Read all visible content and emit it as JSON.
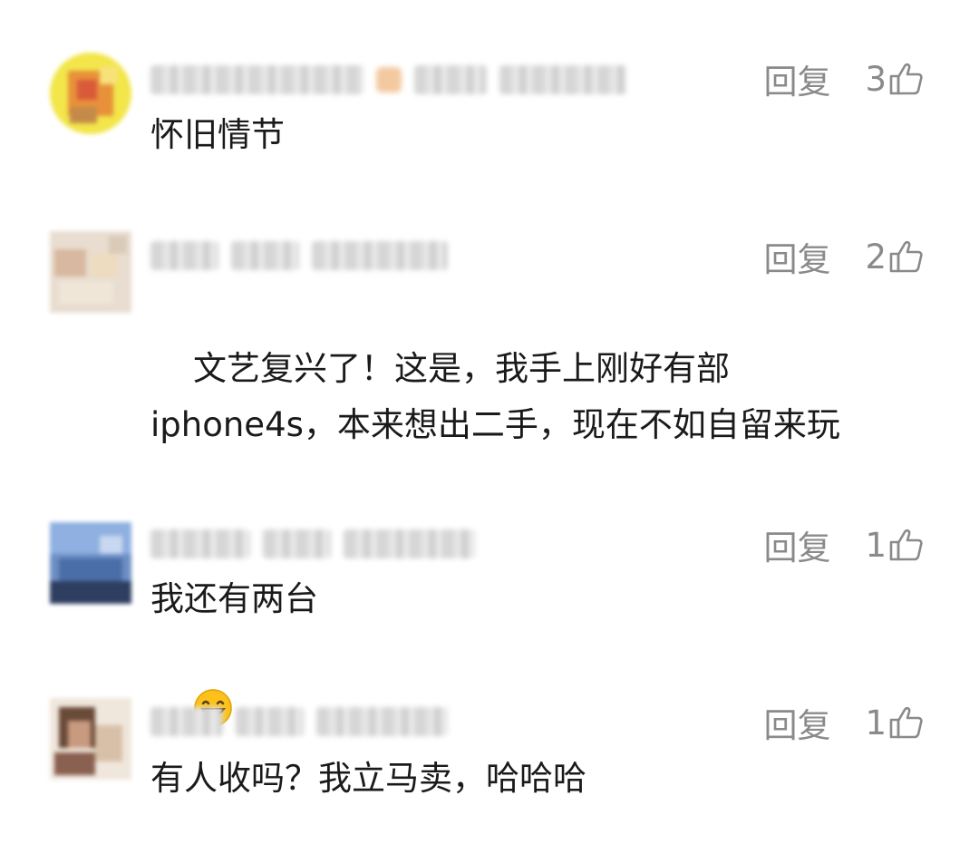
{
  "comments": [
    {
      "reply_label": "回复",
      "like_count": "3",
      "text": "怀旧情节",
      "avatar_style": "round-yellow"
    },
    {
      "reply_label": "回复",
      "like_count": "2",
      "text": "文艺复兴了！这是，我手上刚好有部\niphone4s，本来想出二手，现在不如自留来玩",
      "has_emoji": true,
      "emoji_name": "grinning-face-icon"
    },
    {
      "reply_label": "回复",
      "like_count": "1",
      "text": "我还有两台"
    },
    {
      "reply_label": "回复",
      "like_count": "1",
      "text": "有人收吗？我立马卖，哈哈哈"
    }
  ],
  "colors": {
    "text_primary": "#1a1a1a",
    "text_secondary": "#8a8a8a",
    "background": "#ffffff"
  },
  "icons": {
    "like": "thumbs-up-outline-icon",
    "emoji": "grinning-face-icon"
  }
}
